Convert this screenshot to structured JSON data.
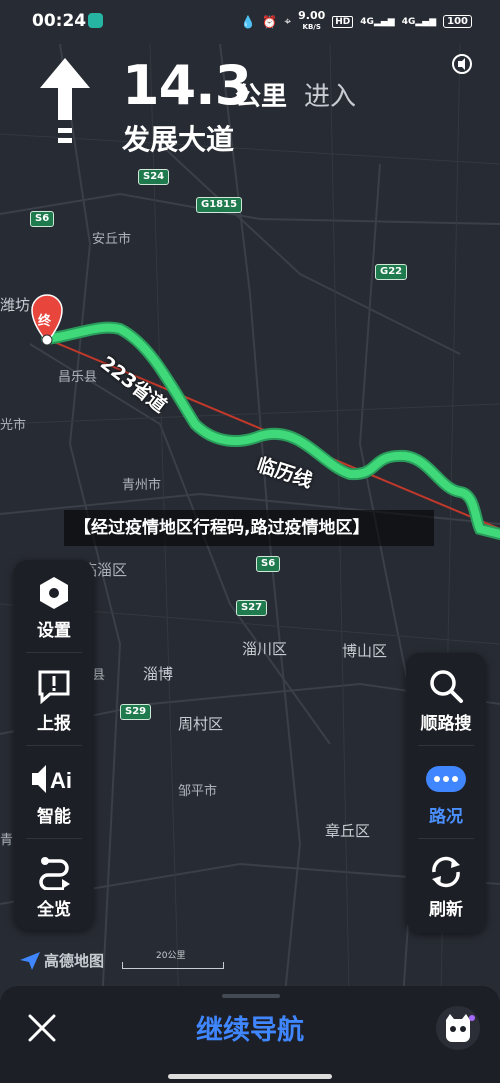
{
  "status_bar": {
    "time": "00:24",
    "speed": "9.00",
    "speed_unit": "KB/S",
    "hd_badge": "HD",
    "signal_1": "4G",
    "signal_2": "4G",
    "battery": "100"
  },
  "guidance": {
    "distance": "14.3",
    "unit": "公里",
    "action": "进入",
    "road_name": "发展大道"
  },
  "map": {
    "destination_marker": "终",
    "route_labels": [
      "223省道",
      "临历线"
    ],
    "places": [
      "安丘市",
      "潍坊",
      "昌乐县",
      "光市",
      "青州市",
      "临淄区",
      "淄川区",
      "博山区",
      "淄博",
      "周村区",
      "邹平市",
      "章丘区",
      "县",
      "青"
    ],
    "shields": [
      "S24",
      "S6",
      "G1815",
      "G22",
      "S6",
      "S27",
      "S29"
    ]
  },
  "news_headline": "【经过疫情地区行程码,路过疫情地区】",
  "left_panel": [
    {
      "label": "设置",
      "icon": "settings-icon"
    },
    {
      "label": "上报",
      "icon": "report-icon"
    },
    {
      "label": "智能",
      "icon": "voice-ai-icon"
    },
    {
      "label": "全览",
      "icon": "overview-icon"
    }
  ],
  "right_panel": [
    {
      "label": "顺路搜",
      "icon": "search-icon"
    },
    {
      "label": "路况",
      "icon": "traffic-icon"
    },
    {
      "label": "刷新",
      "icon": "refresh-icon"
    }
  ],
  "brand": "高德地图",
  "scale_label": "20公里",
  "bottom_bar": {
    "continue_label": "继续导航"
  },
  "colors": {
    "route": "#3fd97a",
    "straight_line": "#c0392b",
    "accent_blue": "#3f86ff",
    "destination": "#e8453c"
  }
}
